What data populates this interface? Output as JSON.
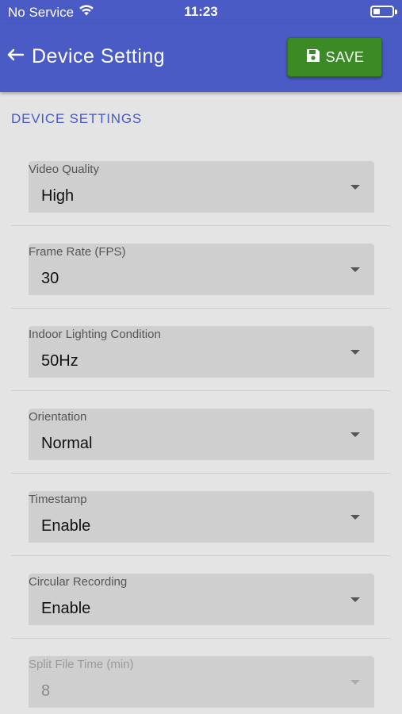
{
  "status_bar": {
    "carrier": "No Service",
    "time": "11:23"
  },
  "app_bar": {
    "title": "Device Setting",
    "save_label": "SAVE"
  },
  "section": {
    "title": "DEVICE SETTINGS"
  },
  "settings": [
    {
      "label": "Video Quality",
      "value": "High"
    },
    {
      "label": "Frame Rate (FPS)",
      "value": "30"
    },
    {
      "label": "Indoor Lighting Condition",
      "value": "50Hz"
    },
    {
      "label": "Orientation",
      "value": "Normal"
    },
    {
      "label": "Timestamp",
      "value": "Enable"
    },
    {
      "label": "Circular Recording",
      "value": "Enable"
    },
    {
      "label": "Split File Time (min)",
      "value": "8",
      "disabled": true
    }
  ],
  "colors": {
    "primary": "#4a5bc6",
    "save_green": "#3c8a26",
    "background": "#e4e4e4",
    "field_bg": "#cfcfcf"
  }
}
